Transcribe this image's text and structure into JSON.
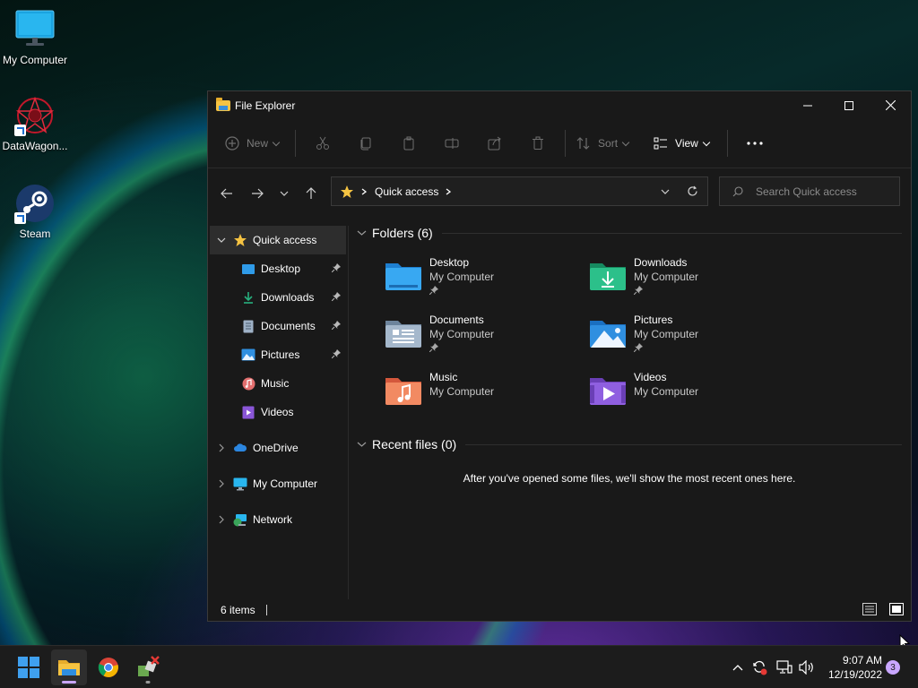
{
  "desktop": {
    "icons": [
      {
        "label": "My Computer",
        "icon": "monitor-icon"
      },
      {
        "label": "DataWagon...",
        "icon": "datawagon-icon"
      },
      {
        "label": "Steam",
        "icon": "steam-icon"
      }
    ]
  },
  "window": {
    "title": "File Explorer",
    "controls": {
      "minimize": "minimize-icon",
      "maximize": "maximize-icon",
      "close": "close-icon"
    }
  },
  "toolbar": {
    "new_label": "New",
    "sort_label": "Sort",
    "view_label": "View",
    "icons": [
      "cut-icon",
      "copy-icon",
      "paste-icon",
      "rename-icon",
      "share-icon",
      "delete-icon"
    ],
    "more": "more-options-icon"
  },
  "address": {
    "location": "Quick access",
    "search_placeholder": "Search Quick access"
  },
  "sidebar": {
    "quick_access": "Quick access",
    "pinned": [
      {
        "label": "Desktop",
        "pinned": true
      },
      {
        "label": "Downloads",
        "pinned": true
      },
      {
        "label": "Documents",
        "pinned": true
      },
      {
        "label": "Pictures",
        "pinned": true
      },
      {
        "label": "Music",
        "pinned": false
      },
      {
        "label": "Videos",
        "pinned": false
      }
    ],
    "roots": [
      {
        "label": "OneDrive"
      },
      {
        "label": "My Computer"
      },
      {
        "label": "Network"
      }
    ]
  },
  "folders": {
    "heading": "Folders (6)",
    "items": [
      {
        "name": "Desktop",
        "location": "My Computer",
        "pinned": true,
        "color": "#2f9be8"
      },
      {
        "name": "Downloads",
        "location": "My Computer",
        "pinned": true,
        "color": "#27b07e"
      },
      {
        "name": "Documents",
        "location": "My Computer",
        "pinned": true,
        "color": "#8aa3bd"
      },
      {
        "name": "Pictures",
        "location": "My Computer",
        "pinned": true,
        "color": "#2f8fe0"
      },
      {
        "name": "Music",
        "location": "My Computer",
        "pinned": false,
        "color": "#f07a54"
      },
      {
        "name": "Videos",
        "location": "My Computer",
        "pinned": false,
        "color": "#8a56d8"
      }
    ]
  },
  "recent": {
    "heading": "Recent files (0)",
    "empty_message": "After you've opened some files, we'll show the most recent ones here."
  },
  "status": {
    "items_count": "6 items"
  },
  "taskbar": {
    "time": "9:07 AM",
    "date": "12/19/2022",
    "notification_count": "3"
  }
}
